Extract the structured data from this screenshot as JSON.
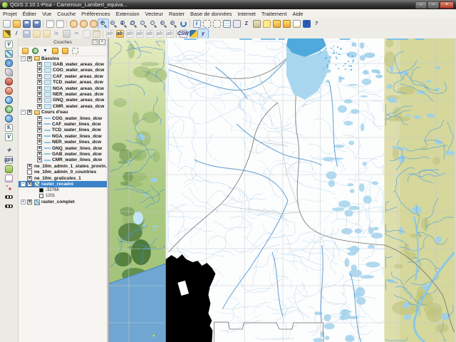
{
  "window": {
    "title": "QGIS 2.10.1-Pisa - Cameroun_Lambert_equiva...",
    "minimize_label": "–",
    "restore_label": "▫",
    "close_label": "×"
  },
  "menu_bar": {
    "items": [
      "Projet",
      "Éditer",
      "Vue",
      "Couche",
      "Préférences",
      "Extension",
      "Vecteur",
      "Raster",
      "Base de données",
      "Internet",
      "Traitement",
      "Aide"
    ]
  },
  "toolbars": {
    "primary": [
      {
        "name": "new-project-button",
        "kind": "file"
      },
      {
        "name": "open-project-button",
        "kind": "folder"
      },
      {
        "name": "save-project-button",
        "kind": "disk"
      },
      {
        "name": "save-project-as-button",
        "kind": "disk"
      },
      "|",
      {
        "name": "new-print-composer-button",
        "kind": "page"
      },
      {
        "name": "composer-manager-button",
        "kind": "page"
      },
      "|",
      {
        "name": "touch-zoom-pan-button",
        "kind": "hand"
      },
      {
        "name": "pan-map-button",
        "kind": "hand"
      },
      {
        "name": "pan-to-selection-button",
        "kind": "hand"
      },
      {
        "name": "zoom-in-button",
        "kind": "mag",
        "glyph": "+",
        "active": true
      },
      {
        "name": "zoom-out-button",
        "kind": "mag",
        "glyph": "-"
      },
      {
        "name": "zoom-actual-size-button",
        "kind": "mag",
        "glyph": "1"
      },
      {
        "name": "zoom-full-extent-button",
        "kind": "mag",
        "glyph": "◻"
      },
      {
        "name": "zoom-to-selection-button",
        "kind": "mag",
        "glyph": ""
      },
      {
        "name": "zoom-to-layer-button",
        "kind": "mag",
        "glyph": ""
      },
      {
        "name": "zoom-last-button",
        "kind": "mag",
        "glyph": "‹"
      },
      {
        "name": "zoom-next-button",
        "kind": "mag",
        "glyph": "›"
      },
      {
        "name": "refresh-map-button",
        "kind": "refresh"
      },
      "|",
      {
        "name": "identify-features-button",
        "kind": "info",
        "glyph": "i"
      },
      {
        "name": "select-features-button",
        "kind": "sel",
        "dropdown": true
      },
      {
        "name": "deselect-features-button",
        "kind": "sel"
      },
      {
        "name": "open-attribute-table-button",
        "kind": "table"
      },
      {
        "name": "field-calculator-button",
        "kind": "calc"
      },
      {
        "name": "statistical-summary-button",
        "kind": "sigma",
        "glyph": "Σ"
      },
      {
        "name": "measure-button",
        "kind": "ruler",
        "dropdown": true
      },
      {
        "name": "map-tips-button",
        "kind": "bubble"
      },
      {
        "name": "new-bookmark-button",
        "kind": "bmark"
      },
      {
        "name": "show-bookmarks-button",
        "kind": "bmark"
      },
      {
        "name": "text-annotation-button",
        "kind": "note",
        "dropdown": true
      },
      {
        "name": "help-contents-button",
        "kind": "help",
        "glyph": "?"
      },
      {
        "name": "whats-this-button",
        "kind": "slash",
        "glyph": "?"
      }
    ],
    "secondary": [
      {
        "name": "current-edits-button",
        "kind": "pencil"
      },
      {
        "name": "toggle-editing-button",
        "kind": "slash",
        "glyph": "/"
      },
      {
        "name": "save-layer-edits-button",
        "kind": "disk",
        "disabled": true
      },
      {
        "name": "add-feature-button",
        "kind": "labelc",
        "disabled": true
      },
      {
        "name": "move-feature-button",
        "kind": "labelc",
        "disabled": true
      },
      {
        "name": "node-tool-button",
        "kind": "slash",
        "glyph": "/x",
        "disabled": true
      },
      {
        "name": "delete-selected-button",
        "kind": "trash",
        "disabled": true
      },
      {
        "name": "cut-features-button",
        "kind": "scissors",
        "glyph": "✂",
        "disabled": true
      },
      {
        "name": "copy-features-button",
        "kind": "copy",
        "disabled": true
      },
      {
        "name": "paste-features-button",
        "kind": "paste",
        "disabled": true
      },
      "|",
      {
        "name": "highlight-pinned-labels-button",
        "kind": "label",
        "glyph": "ab",
        "disabled": true
      },
      {
        "name": "layer-labeling-options-button",
        "kind": "labelc",
        "glyph": "ab"
      },
      {
        "name": "pin-unpin-labels-button",
        "kind": "label",
        "glyph": "ab",
        "disabled": true
      },
      {
        "name": "show-hide-labels-button",
        "kind": "label",
        "glyph": "ab",
        "disabled": true
      },
      {
        "name": "move-label-button",
        "kind": "label",
        "glyph": "ab",
        "disabled": true
      },
      {
        "name": "rotate-label-button",
        "kind": "label",
        "glyph": "ab",
        "disabled": true
      },
      {
        "name": "change-label-button",
        "kind": "label",
        "glyph": "ab",
        "disabled": true
      },
      "|",
      {
        "name": "metasearch-csw-button",
        "kind": "csw",
        "glyph": "CSW"
      },
      {
        "name": "python-console-button",
        "kind": "python"
      },
      {
        "name": "console-button",
        "kind": "ycon",
        "glyph": "y",
        "active": true
      }
    ],
    "layers_toolbar": [
      {
        "name": "add-group-button",
        "kind": "folder"
      },
      {
        "name": "manage-layer-visibility-button",
        "kind": "globe2"
      },
      {
        "name": "filter-legend-button",
        "kind": "sigma",
        "glyph": "▼"
      },
      {
        "name": "expand-all-button",
        "kind": "bmark"
      },
      {
        "name": "collapse-all-button",
        "kind": "bmark"
      },
      {
        "name": "remove-layer-button",
        "kind": "sel"
      }
    ],
    "left": [
      {
        "name": "add-vector-layer-button",
        "kind": "vec",
        "glyph": "V"
      },
      {
        "name": "add-raster-layer-button",
        "kind": "ras"
      },
      {
        "name": "add-postgis-layer-button",
        "kind": "db"
      },
      {
        "name": "add-spatialite-layer-button",
        "kind": "feather"
      },
      {
        "name": "add-mssql-layer-button",
        "kind": "mssql"
      },
      {
        "name": "add-oracle-layer-button",
        "kind": "oracle"
      },
      {
        "name": "add-wms-layer-button",
        "kind": "globe"
      },
      {
        "name": "add-wcs-layer-button",
        "kind": "globe2"
      },
      {
        "name": "add-wfs-layer-button",
        "kind": "globe"
      },
      {
        "name": "add-delimited-text-layer-button",
        "kind": "txt",
        "glyph": "9,"
      },
      {
        "name": "new-shapefile-layer-button",
        "kind": "shp",
        "glyph": "V"
      },
      {
        "name": "sep",
        "kind": "sep"
      },
      {
        "name": "coordinate-capture-button",
        "kind": "coord",
        "glyph": "✛"
      },
      {
        "name": "gps-information-button",
        "kind": "gps",
        "glyph": "gps"
      },
      {
        "name": "plugin-tool-button",
        "kind": "plug"
      },
      {
        "name": "map-annotation-button",
        "kind": "anno"
      },
      {
        "name": "osm-place-search-button",
        "kind": "osm"
      },
      {
        "name": "scale-bar-button",
        "kind": "scale"
      },
      {
        "name": "scale-bar-2-button",
        "kind": "scale"
      }
    ]
  },
  "layers_panel": {
    "title": "Couches",
    "float_label": "◻",
    "close_label": "×",
    "tree": [
      {
        "type": "group",
        "label": "Bassins",
        "checked": true,
        "expanded": true,
        "children": [
          {
            "type": "layer",
            "label": "GAB_water_areas_dcw",
            "checked": true,
            "swatch": "area"
          },
          {
            "type": "layer",
            "label": "COG_water_areas_dcw",
            "checked": true,
            "swatch": "area"
          },
          {
            "type": "layer",
            "label": "CAF_water_areas_dcw",
            "checked": true,
            "swatch": "area"
          },
          {
            "type": "layer",
            "label": "TCD_water_areas_dcw",
            "checked": true,
            "swatch": "area"
          },
          {
            "type": "layer",
            "label": "NGA_water_areas_dcw",
            "checked": true,
            "swatch": "area"
          },
          {
            "type": "layer",
            "label": "NER_water_areas_dcw",
            "checked": true,
            "swatch": "area"
          },
          {
            "type": "layer",
            "label": "GNQ_water_areas_dcw",
            "checked": true,
            "swatch": "area"
          },
          {
            "type": "layer",
            "label": "CMR_water_areas_dcw",
            "checked": true,
            "swatch": "area"
          }
        ]
      },
      {
        "type": "group",
        "label": "Cours d'eau",
        "checked": true,
        "expanded": true,
        "children": [
          {
            "type": "layer",
            "label": "COG_water_lines_dcw",
            "checked": true,
            "swatch": "line"
          },
          {
            "type": "layer",
            "label": "CAF_water_lines_dcw",
            "checked": true,
            "swatch": "line"
          },
          {
            "type": "layer",
            "label": "TCD_water_lines_dcw",
            "checked": true,
            "swatch": "line"
          },
          {
            "type": "layer",
            "label": "NGA_water_lines_dcw",
            "checked": true,
            "swatch": "line"
          },
          {
            "type": "layer",
            "label": "NER_water_lines_dcw",
            "checked": true,
            "swatch": "line"
          },
          {
            "type": "layer",
            "label": "GNQ_water_lines_dcw",
            "checked": true,
            "swatch": "line"
          },
          {
            "type": "layer",
            "label": "GAB_water_lines_dcw",
            "checked": true,
            "swatch": "line"
          },
          {
            "type": "layer",
            "label": "CMR_water_lines_dcw",
            "checked": true,
            "swatch": "line"
          }
        ]
      },
      {
        "type": "layer",
        "label": "ne_10m_admin_1_states_provin...",
        "checked": true
      },
      {
        "type": "layer",
        "label": "ne_10m_admin_0_countries",
        "checked": false
      },
      {
        "type": "layer",
        "label": "ne_10m_graticules_1",
        "checked": true
      },
      {
        "type": "raster",
        "label": "raster_recadré",
        "checked": true,
        "expanded": true,
        "selected": true,
        "children": [
          {
            "type": "legend",
            "label": "-32768",
            "swatch_color": "#000000"
          },
          {
            "type": "legend",
            "label": "1201",
            "swatch_color": "#ffffff"
          }
        ]
      },
      {
        "type": "raster",
        "label": "raster_complet",
        "checked": true,
        "expanded": false,
        "children": []
      }
    ]
  },
  "map": {
    "colors": {
      "white_strip": "#fcfdfd",
      "left_strip_top": "#e6ecbe",
      "left_strip_mid": "#aecb84",
      "left_strip_dark": "#55803f",
      "right_strip": "#d5d79b",
      "right_strip_dark": "#babe74",
      "ocean": "#6fa7d2",
      "water_line": "#a9cfe9",
      "water_line_strip": "#4f94cc",
      "river_major": "#5b9bd5",
      "water_area": "#a8d6ee",
      "lake_dark": "#4fa9da",
      "boundary": "#70706c",
      "state_line": "#a2a29e",
      "graticule": "#c6cad2",
      "nodata": "#000000"
    }
  }
}
